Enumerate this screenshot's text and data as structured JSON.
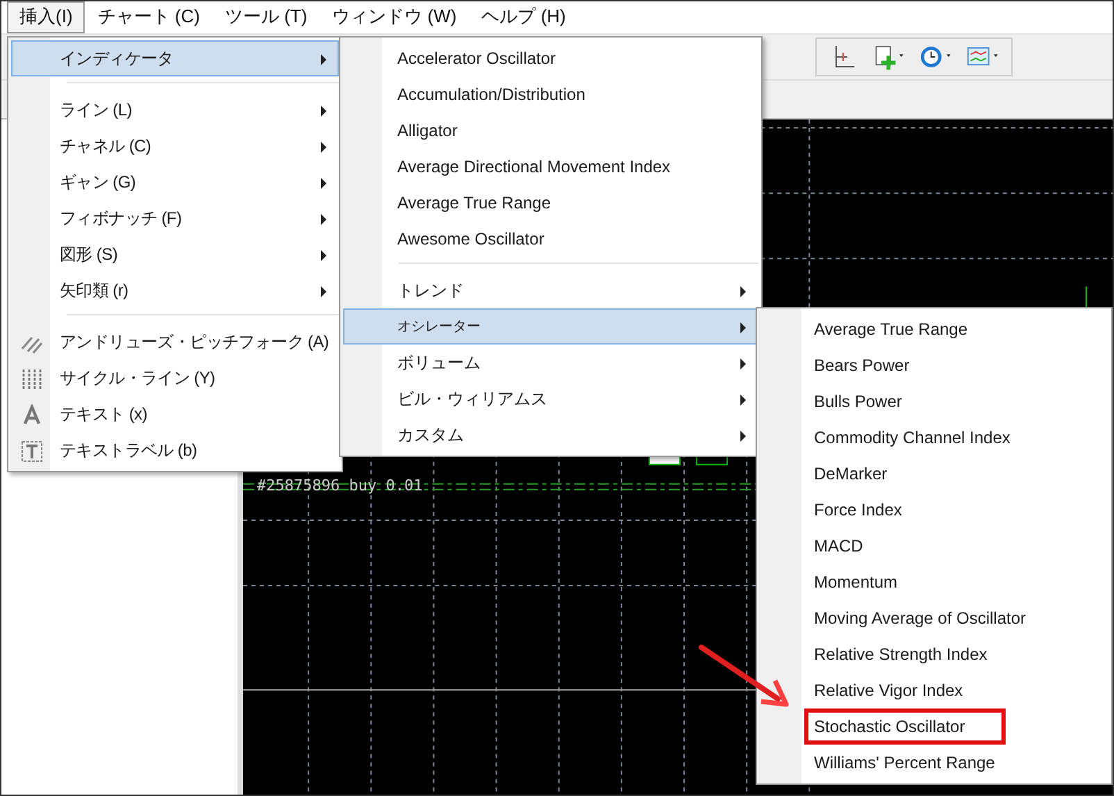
{
  "menubar": [
    {
      "label": "挿入(I)",
      "selected": true
    },
    {
      "label": "チャート (C)",
      "selected": false
    },
    {
      "label": "ツール (T)",
      "selected": false
    },
    {
      "label": "ウィンドウ (W)",
      "selected": false
    },
    {
      "label": "ヘルプ (H)",
      "selected": false
    }
  ],
  "insert_menu": [
    {
      "kind": "submenu",
      "label": "インディケータ",
      "selected": true
    },
    {
      "kind": "separator"
    },
    {
      "kind": "submenu",
      "label": "ライン (L)",
      "selected": false
    },
    {
      "kind": "submenu",
      "label": "チャネル (C)",
      "selected": false
    },
    {
      "kind": "submenu",
      "label": "ギャン (G)",
      "selected": false
    },
    {
      "kind": "submenu",
      "label": "フィボナッチ (F)",
      "selected": false
    },
    {
      "kind": "submenu",
      "label": "図形 (S)",
      "selected": false
    },
    {
      "kind": "submenu",
      "label": "矢印類 (r)",
      "selected": false
    },
    {
      "kind": "separator"
    },
    {
      "kind": "tool",
      "label": "アンドリューズ・ピッチフォーク (A)",
      "selected": false
    },
    {
      "kind": "tool",
      "label": "サイクル・ライン (Y)",
      "selected": false
    },
    {
      "kind": "tool",
      "label": "テキスト (x)",
      "selected": false
    },
    {
      "kind": "tool",
      "label": "テキストラベル (b)",
      "selected": false
    }
  ],
  "indicator_menu": [
    {
      "kind": "item",
      "label": "Accelerator Oscillator",
      "selected": false
    },
    {
      "kind": "item",
      "label": "Accumulation/Distribution",
      "selected": false
    },
    {
      "kind": "item",
      "label": "Alligator",
      "selected": false
    },
    {
      "kind": "item",
      "label": "Average Directional Movement Index",
      "selected": false
    },
    {
      "kind": "item",
      "label": "Average True Range",
      "selected": false
    },
    {
      "kind": "item",
      "label": "Awesome Oscillator",
      "selected": false
    },
    {
      "kind": "separator"
    },
    {
      "kind": "submenu",
      "label": "トレンド",
      "selected": false
    },
    {
      "kind": "submenu",
      "label": "オシレーター",
      "selected": true
    },
    {
      "kind": "submenu",
      "label": "ボリューム",
      "selected": false
    },
    {
      "kind": "submenu",
      "label": "ビル・ウィリアムス",
      "selected": false
    },
    {
      "kind": "submenu",
      "label": "カスタム",
      "selected": false
    }
  ],
  "oscillator_menu": [
    {
      "label": "Average True Range",
      "marked": false
    },
    {
      "label": "Bears Power",
      "marked": false
    },
    {
      "label": "Bulls Power",
      "marked": false
    },
    {
      "label": "Commodity Channel Index",
      "marked": false
    },
    {
      "label": "DeMarker",
      "marked": false
    },
    {
      "label": "Force Index",
      "marked": false
    },
    {
      "label": "MACD",
      "marked": false
    },
    {
      "label": "Momentum",
      "marked": false
    },
    {
      "label": "Moving Average of Oscillator",
      "marked": false
    },
    {
      "label": "Relative Strength Index",
      "marked": false
    },
    {
      "label": "Relative Vigor Index",
      "marked": false
    },
    {
      "label": "Stochastic Oscillator",
      "marked": true
    },
    {
      "label": "Williams' Percent Range",
      "marked": false
    }
  ],
  "chart": {
    "order_label": "#25875896 buy 0.01"
  }
}
